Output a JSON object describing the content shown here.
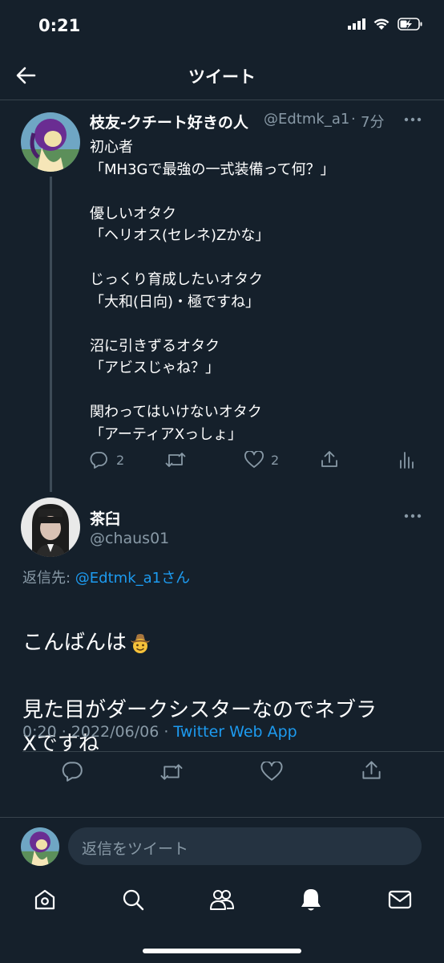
{
  "status_bar": {
    "time": "0:21"
  },
  "header": {
    "title": "ツイート"
  },
  "tweet1": {
    "name": "枝友-クチート好きの人",
    "handle": "@Edtmk_a1",
    "separator": "·",
    "time": "7分",
    "body": "初心者\n「MH3Gで最強の一式装備って何？」\n\n優しいオタク\n「ヘリオス(セレネ)Zかな」\n\nじっくり育成したいオタク\n「大和(日向)・極ですね」\n\n沼に引きずるオタク\n「アビスじゃね？」\n\n関わってはいけないオタク\n「アーティアXっしょ」",
    "reply_count": "2",
    "like_count": "2"
  },
  "tweet2": {
    "name": "茶臼",
    "handle": "@chaus01",
    "reply_to_prefix": "返信先: ",
    "reply_to_user": "@Edtmk_a1",
    "reply_to_suffix": "さん",
    "body_line1": "こんばんは",
    "body_rest": "見た目がダークシスターなのでネブラ\nXですね",
    "timestamp": "0:20 · 2022/06/06 · ",
    "source": "Twitter Web App"
  },
  "compose": {
    "placeholder": "返信をツイート"
  },
  "colors": {
    "background": "#15202b",
    "accent": "#1d9bf0",
    "muted": "#8899a6",
    "divider": "#38444d"
  },
  "icons": [
    "back-arrow-icon",
    "signal-icon",
    "wifi-icon",
    "battery-charging-icon",
    "reply-icon",
    "retweet-icon",
    "like-icon",
    "share-icon",
    "analytics-icon",
    "more-icon",
    "home-icon",
    "search-icon",
    "communities-icon",
    "notifications-icon",
    "messages-icon",
    "cowboy-emoji"
  ]
}
